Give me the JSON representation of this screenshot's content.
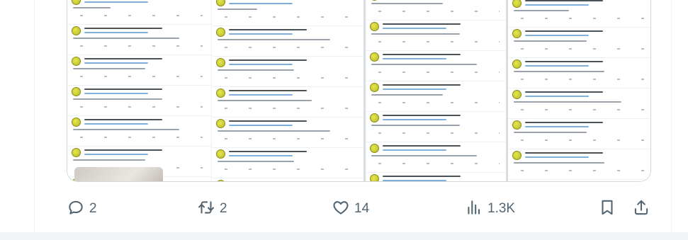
{
  "tweet_actions": {
    "replies": "2",
    "reposts": "2",
    "likes": "14",
    "views": "1.3K"
  },
  "icons": {
    "reply": "reply-bubble-icon",
    "repost": "repost-arrows-icon",
    "like": "heart-icon",
    "views": "bar-chart-icon",
    "bookmark": "bookmark-icon",
    "share": "share-upload-icon"
  },
  "colors": {
    "icon_gray": "#536471",
    "border": "#cfd9de",
    "avatar_yellow": "#d4d63a"
  }
}
